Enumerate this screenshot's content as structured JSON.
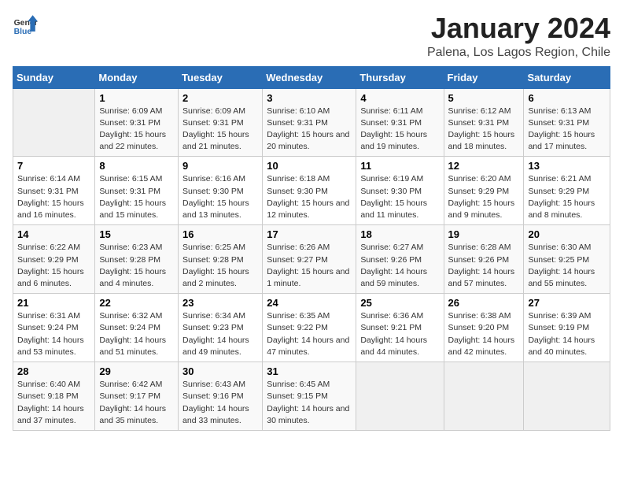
{
  "logo": {
    "general": "General",
    "blue": "Blue"
  },
  "title": "January 2024",
  "location": "Palena, Los Lagos Region, Chile",
  "days_of_week": [
    "Sunday",
    "Monday",
    "Tuesday",
    "Wednesday",
    "Thursday",
    "Friday",
    "Saturday"
  ],
  "weeks": [
    [
      null,
      {
        "day": "1",
        "sunrise": "Sunrise: 6:09 AM",
        "sunset": "Sunset: 9:31 PM",
        "daylight": "Daylight: 15 hours and 22 minutes."
      },
      {
        "day": "2",
        "sunrise": "Sunrise: 6:09 AM",
        "sunset": "Sunset: 9:31 PM",
        "daylight": "Daylight: 15 hours and 21 minutes."
      },
      {
        "day": "3",
        "sunrise": "Sunrise: 6:10 AM",
        "sunset": "Sunset: 9:31 PM",
        "daylight": "Daylight: 15 hours and 20 minutes."
      },
      {
        "day": "4",
        "sunrise": "Sunrise: 6:11 AM",
        "sunset": "Sunset: 9:31 PM",
        "daylight": "Daylight: 15 hours and 19 minutes."
      },
      {
        "day": "5",
        "sunrise": "Sunrise: 6:12 AM",
        "sunset": "Sunset: 9:31 PM",
        "daylight": "Daylight: 15 hours and 18 minutes."
      },
      {
        "day": "6",
        "sunrise": "Sunrise: 6:13 AM",
        "sunset": "Sunset: 9:31 PM",
        "daylight": "Daylight: 15 hours and 17 minutes."
      }
    ],
    [
      {
        "day": "7",
        "sunrise": "Sunrise: 6:14 AM",
        "sunset": "Sunset: 9:31 PM",
        "daylight": "Daylight: 15 hours and 16 minutes."
      },
      {
        "day": "8",
        "sunrise": "Sunrise: 6:15 AM",
        "sunset": "Sunset: 9:31 PM",
        "daylight": "Daylight: 15 hours and 15 minutes."
      },
      {
        "day": "9",
        "sunrise": "Sunrise: 6:16 AM",
        "sunset": "Sunset: 9:30 PM",
        "daylight": "Daylight: 15 hours and 13 minutes."
      },
      {
        "day": "10",
        "sunrise": "Sunrise: 6:18 AM",
        "sunset": "Sunset: 9:30 PM",
        "daylight": "Daylight: 15 hours and 12 minutes."
      },
      {
        "day": "11",
        "sunrise": "Sunrise: 6:19 AM",
        "sunset": "Sunset: 9:30 PM",
        "daylight": "Daylight: 15 hours and 11 minutes."
      },
      {
        "day": "12",
        "sunrise": "Sunrise: 6:20 AM",
        "sunset": "Sunset: 9:29 PM",
        "daylight": "Daylight: 15 hours and 9 minutes."
      },
      {
        "day": "13",
        "sunrise": "Sunrise: 6:21 AM",
        "sunset": "Sunset: 9:29 PM",
        "daylight": "Daylight: 15 hours and 8 minutes."
      }
    ],
    [
      {
        "day": "14",
        "sunrise": "Sunrise: 6:22 AM",
        "sunset": "Sunset: 9:29 PM",
        "daylight": "Daylight: 15 hours and 6 minutes."
      },
      {
        "day": "15",
        "sunrise": "Sunrise: 6:23 AM",
        "sunset": "Sunset: 9:28 PM",
        "daylight": "Daylight: 15 hours and 4 minutes."
      },
      {
        "day": "16",
        "sunrise": "Sunrise: 6:25 AM",
        "sunset": "Sunset: 9:28 PM",
        "daylight": "Daylight: 15 hours and 2 minutes."
      },
      {
        "day": "17",
        "sunrise": "Sunrise: 6:26 AM",
        "sunset": "Sunset: 9:27 PM",
        "daylight": "Daylight: 15 hours and 1 minute."
      },
      {
        "day": "18",
        "sunrise": "Sunrise: 6:27 AM",
        "sunset": "Sunset: 9:26 PM",
        "daylight": "Daylight: 14 hours and 59 minutes."
      },
      {
        "day": "19",
        "sunrise": "Sunrise: 6:28 AM",
        "sunset": "Sunset: 9:26 PM",
        "daylight": "Daylight: 14 hours and 57 minutes."
      },
      {
        "day": "20",
        "sunrise": "Sunrise: 6:30 AM",
        "sunset": "Sunset: 9:25 PM",
        "daylight": "Daylight: 14 hours and 55 minutes."
      }
    ],
    [
      {
        "day": "21",
        "sunrise": "Sunrise: 6:31 AM",
        "sunset": "Sunset: 9:24 PM",
        "daylight": "Daylight: 14 hours and 53 minutes."
      },
      {
        "day": "22",
        "sunrise": "Sunrise: 6:32 AM",
        "sunset": "Sunset: 9:24 PM",
        "daylight": "Daylight: 14 hours and 51 minutes."
      },
      {
        "day": "23",
        "sunrise": "Sunrise: 6:34 AM",
        "sunset": "Sunset: 9:23 PM",
        "daylight": "Daylight: 14 hours and 49 minutes."
      },
      {
        "day": "24",
        "sunrise": "Sunrise: 6:35 AM",
        "sunset": "Sunset: 9:22 PM",
        "daylight": "Daylight: 14 hours and 47 minutes."
      },
      {
        "day": "25",
        "sunrise": "Sunrise: 6:36 AM",
        "sunset": "Sunset: 9:21 PM",
        "daylight": "Daylight: 14 hours and 44 minutes."
      },
      {
        "day": "26",
        "sunrise": "Sunrise: 6:38 AM",
        "sunset": "Sunset: 9:20 PM",
        "daylight": "Daylight: 14 hours and 42 minutes."
      },
      {
        "day": "27",
        "sunrise": "Sunrise: 6:39 AM",
        "sunset": "Sunset: 9:19 PM",
        "daylight": "Daylight: 14 hours and 40 minutes."
      }
    ],
    [
      {
        "day": "28",
        "sunrise": "Sunrise: 6:40 AM",
        "sunset": "Sunset: 9:18 PM",
        "daylight": "Daylight: 14 hours and 37 minutes."
      },
      {
        "day": "29",
        "sunrise": "Sunrise: 6:42 AM",
        "sunset": "Sunset: 9:17 PM",
        "daylight": "Daylight: 14 hours and 35 minutes."
      },
      {
        "day": "30",
        "sunrise": "Sunrise: 6:43 AM",
        "sunset": "Sunset: 9:16 PM",
        "daylight": "Daylight: 14 hours and 33 minutes."
      },
      {
        "day": "31",
        "sunrise": "Sunrise: 6:45 AM",
        "sunset": "Sunset: 9:15 PM",
        "daylight": "Daylight: 14 hours and 30 minutes."
      },
      null,
      null,
      null
    ]
  ]
}
